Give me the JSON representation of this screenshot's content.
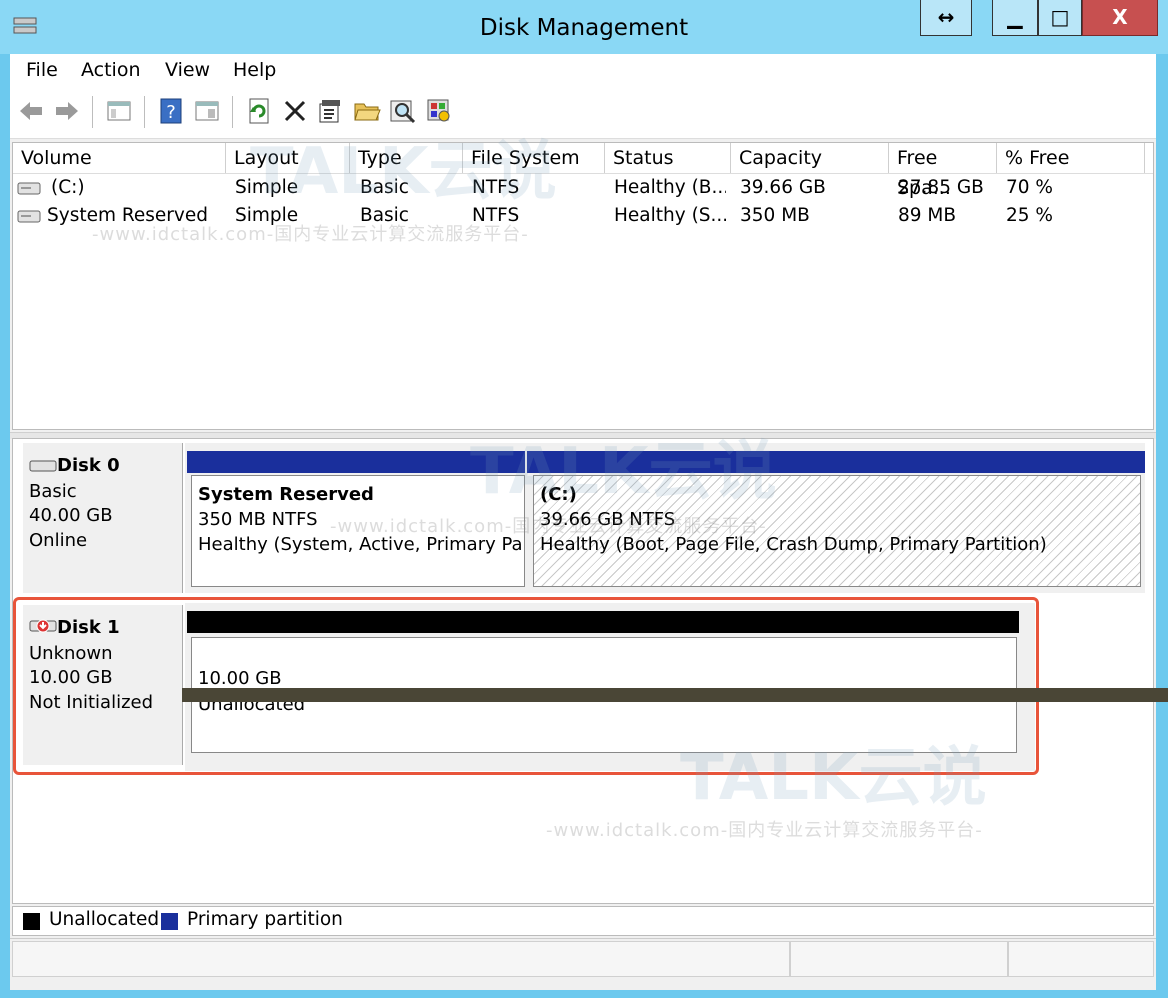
{
  "window": {
    "title": "Disk Management",
    "restore_glyph": "↔",
    "minimize_glyph": "▁",
    "maximize_glyph": "□",
    "close_glyph": "X"
  },
  "menu": {
    "items": [
      "File",
      "Action",
      "View",
      "Help"
    ]
  },
  "toolbar": {
    "icons": [
      "back-icon",
      "forward-icon",
      "console-tree-icon",
      "help-icon",
      "show-hide-icon",
      "refresh-icon",
      "delete-icon",
      "properties-icon",
      "open-icon",
      "find-icon",
      "settings-icon"
    ]
  },
  "volumes": {
    "headers": [
      "Volume",
      "Layout",
      "Type",
      "File System",
      "Status",
      "Capacity",
      "Free Spa...",
      "% Free"
    ],
    "rows": [
      {
        "volume": "(C:)",
        "layout": "Simple",
        "type": "Basic",
        "fs": "NTFS",
        "status": "Healthy (B...",
        "capacity": "39.66 GB",
        "free": "27.85 GB",
        "pct": "70 %"
      },
      {
        "volume": "System Reserved",
        "layout": "Simple",
        "type": "Basic",
        "fs": "NTFS",
        "status": "Healthy (S...",
        "capacity": "350 MB",
        "free": "89 MB",
        "pct": "25 %"
      }
    ]
  },
  "disks": [
    {
      "name": "Disk 0",
      "type": "Basic",
      "size": "40.00 GB",
      "state": "Online",
      "partitions": [
        {
          "label": "System Reserved",
          "size_fs": "350 MB NTFS",
          "status": "Healthy (System, Active, Primary Par"
        },
        {
          "label": "(C:)",
          "size_fs": "39.66 GB NTFS",
          "status": "Healthy (Boot, Page File, Crash Dump, Primary Partition)"
        }
      ]
    },
    {
      "name": "Disk 1",
      "type": "Unknown",
      "size": "10.00 GB",
      "state": "Not Initialized",
      "partitions": [
        {
          "size": "10.00 GB",
          "status": "Unallocated"
        }
      ]
    }
  ],
  "legend": {
    "items": [
      "Unallocated",
      "Primary partition"
    ]
  },
  "colors": {
    "primary": "#1a2f9c",
    "unallocated": "#000000",
    "highlight": "#e8543a",
    "titlebar": "#8ad8f5"
  },
  "watermark": {
    "brand": "TALK云说",
    "line": "-www.idctalk.com-国内专业云计算交流服务平台-"
  }
}
